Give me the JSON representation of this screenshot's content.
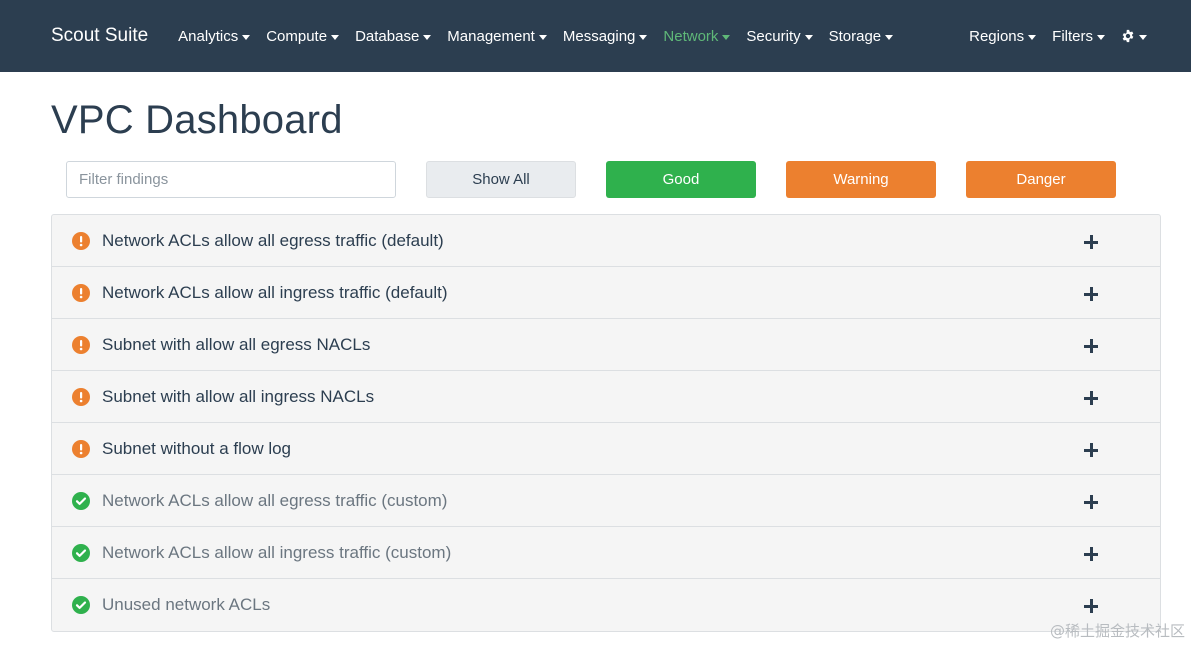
{
  "navbar": {
    "brand": "Scout Suite",
    "menus": [
      {
        "label": "Analytics",
        "active": false
      },
      {
        "label": "Compute",
        "active": false
      },
      {
        "label": "Database",
        "active": false
      },
      {
        "label": "Management",
        "active": false
      },
      {
        "label": "Messaging",
        "active": false
      },
      {
        "label": "Network",
        "active": true
      },
      {
        "label": "Security",
        "active": false
      },
      {
        "label": "Storage",
        "active": false
      }
    ],
    "right_menus": [
      {
        "label": "Regions"
      },
      {
        "label": "Filters"
      }
    ],
    "settings_icon": "gear-icon"
  },
  "page": {
    "title": "VPC Dashboard"
  },
  "filters": {
    "search_placeholder": "Filter findings",
    "search_value": "",
    "show_all_label": "Show All",
    "good_label": "Good",
    "warning_label": "Warning",
    "danger_label": "Danger"
  },
  "findings": [
    {
      "label": "Network ACLs allow all egress traffic (default)",
      "status": "warning",
      "icon": "exclamation-icon"
    },
    {
      "label": "Network ACLs allow all ingress traffic (default)",
      "status": "warning",
      "icon": "exclamation-icon"
    },
    {
      "label": "Subnet with allow all egress NACLs",
      "status": "warning",
      "icon": "exclamation-icon"
    },
    {
      "label": "Subnet with allow all ingress NACLs",
      "status": "warning",
      "icon": "exclamation-icon"
    },
    {
      "label": "Subnet without a flow log",
      "status": "warning",
      "icon": "exclamation-icon"
    },
    {
      "label": "Network ACLs allow all egress traffic (custom)",
      "status": "good",
      "icon": "check-icon"
    },
    {
      "label": "Network ACLs allow all ingress traffic (custom)",
      "status": "good",
      "icon": "check-icon"
    },
    {
      "label": "Unused network ACLs",
      "status": "good",
      "icon": "check-icon"
    }
  ],
  "colors": {
    "navbar_bg": "#2c3e50",
    "active_nav": "#5fb878",
    "good": "#2fb14d",
    "warning": "#ec802f",
    "danger": "#ec802f"
  },
  "watermark": "@稀土掘金技术社区"
}
